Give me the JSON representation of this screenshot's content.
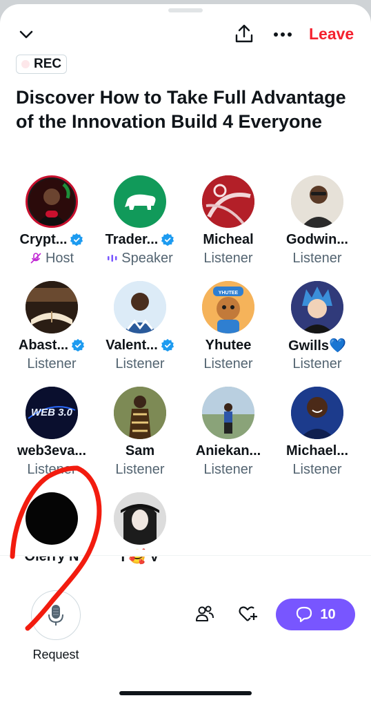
{
  "header": {
    "leave_label": "Leave"
  },
  "rec_badge": {
    "label": "REC"
  },
  "space": {
    "title": "Discover How to Take Full Advantage of the Innovation Build 4 Everyone"
  },
  "participants": [
    {
      "name": "Crypt...",
      "role": "Host",
      "verified": true,
      "role_icon": "mic-off-icon"
    },
    {
      "name": "Trader...",
      "role": "Speaker",
      "verified": true,
      "role_icon": "audio-wave-icon"
    },
    {
      "name": "Micheal",
      "role": "Listener",
      "verified": false
    },
    {
      "name": "Godwin...",
      "role": "Listener",
      "verified": false
    },
    {
      "name": "Abast...",
      "role": "Listener",
      "verified": true
    },
    {
      "name": "Valent...",
      "role": "Listener",
      "verified": true
    },
    {
      "name": "Yhutee",
      "role": "Listener",
      "verified": false
    },
    {
      "name": "Gwills💙",
      "role": "Listener",
      "verified": false
    },
    {
      "name": "web3eva...",
      "role": "Listener",
      "verified": false
    },
    {
      "name": "Sam",
      "role": "Listener",
      "verified": false
    },
    {
      "name": "Aniekan...",
      "role": "Listener",
      "verified": false
    },
    {
      "name": "Michael...",
      "role": "Listener",
      "verified": false
    },
    {
      "name": "Oierry N",
      "role": "",
      "verified": false
    },
    {
      "name": "I 🥰 V",
      "role": "",
      "verified": false
    }
  ],
  "avatar_text": {
    "yhutee_badge": "YHUTEE",
    "web3": "WEB 3.0"
  },
  "footer": {
    "request_label": "Request",
    "comment_count": "10"
  },
  "colors": {
    "accent_purple": "#7856ff",
    "leave_red": "#f4212e",
    "verified_blue": "#1d9bf0",
    "annotation_red": "#f21c0f"
  }
}
